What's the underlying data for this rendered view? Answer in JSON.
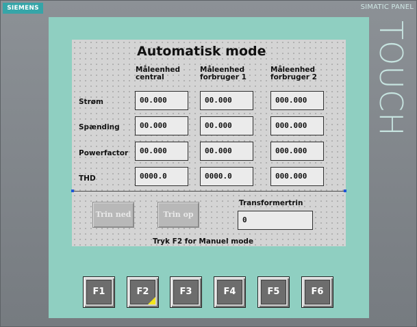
{
  "device": {
    "brand": "SIEMENS",
    "model": "SIMATIC PANEL",
    "touch_label": "TOUCH"
  },
  "screen": {
    "title": "Automatisk mode",
    "columns": [
      "Måleenhed\ncentral",
      "Måleenhed\nforbruger 1",
      "Måleenhed\nforbruger 2"
    ],
    "rows": [
      {
        "label": "Strøm",
        "values": [
          "00.000",
          "00.000",
          "000.000"
        ]
      },
      {
        "label": "Spænding",
        "values": [
          "00.000",
          "00.000",
          "000.000"
        ]
      },
      {
        "label": "Powerfactor",
        "values": [
          "00.000",
          "00.000",
          "000.000"
        ]
      },
      {
        "label": "THD",
        "values": [
          "0000.0",
          "0000.0",
          "000.000"
        ]
      }
    ],
    "trin_ned_label": "Trin ned",
    "trin_op_label": "Trin op",
    "transformertrin_label": "Transformertrin",
    "transformertrin_value": "0",
    "footer_hint": "Tryk F2 for Manuel mode"
  },
  "function_keys": [
    {
      "label": "F1"
    },
    {
      "label": "F2"
    },
    {
      "label": "F3"
    },
    {
      "label": "F4"
    },
    {
      "label": "F5"
    },
    {
      "label": "F6"
    }
  ],
  "colors": {
    "bezel": "#8fcfc1",
    "brand_badge": "#36a5a8",
    "selection_handle": "#1f56d8",
    "f2_marker": "#f2e51c"
  }
}
